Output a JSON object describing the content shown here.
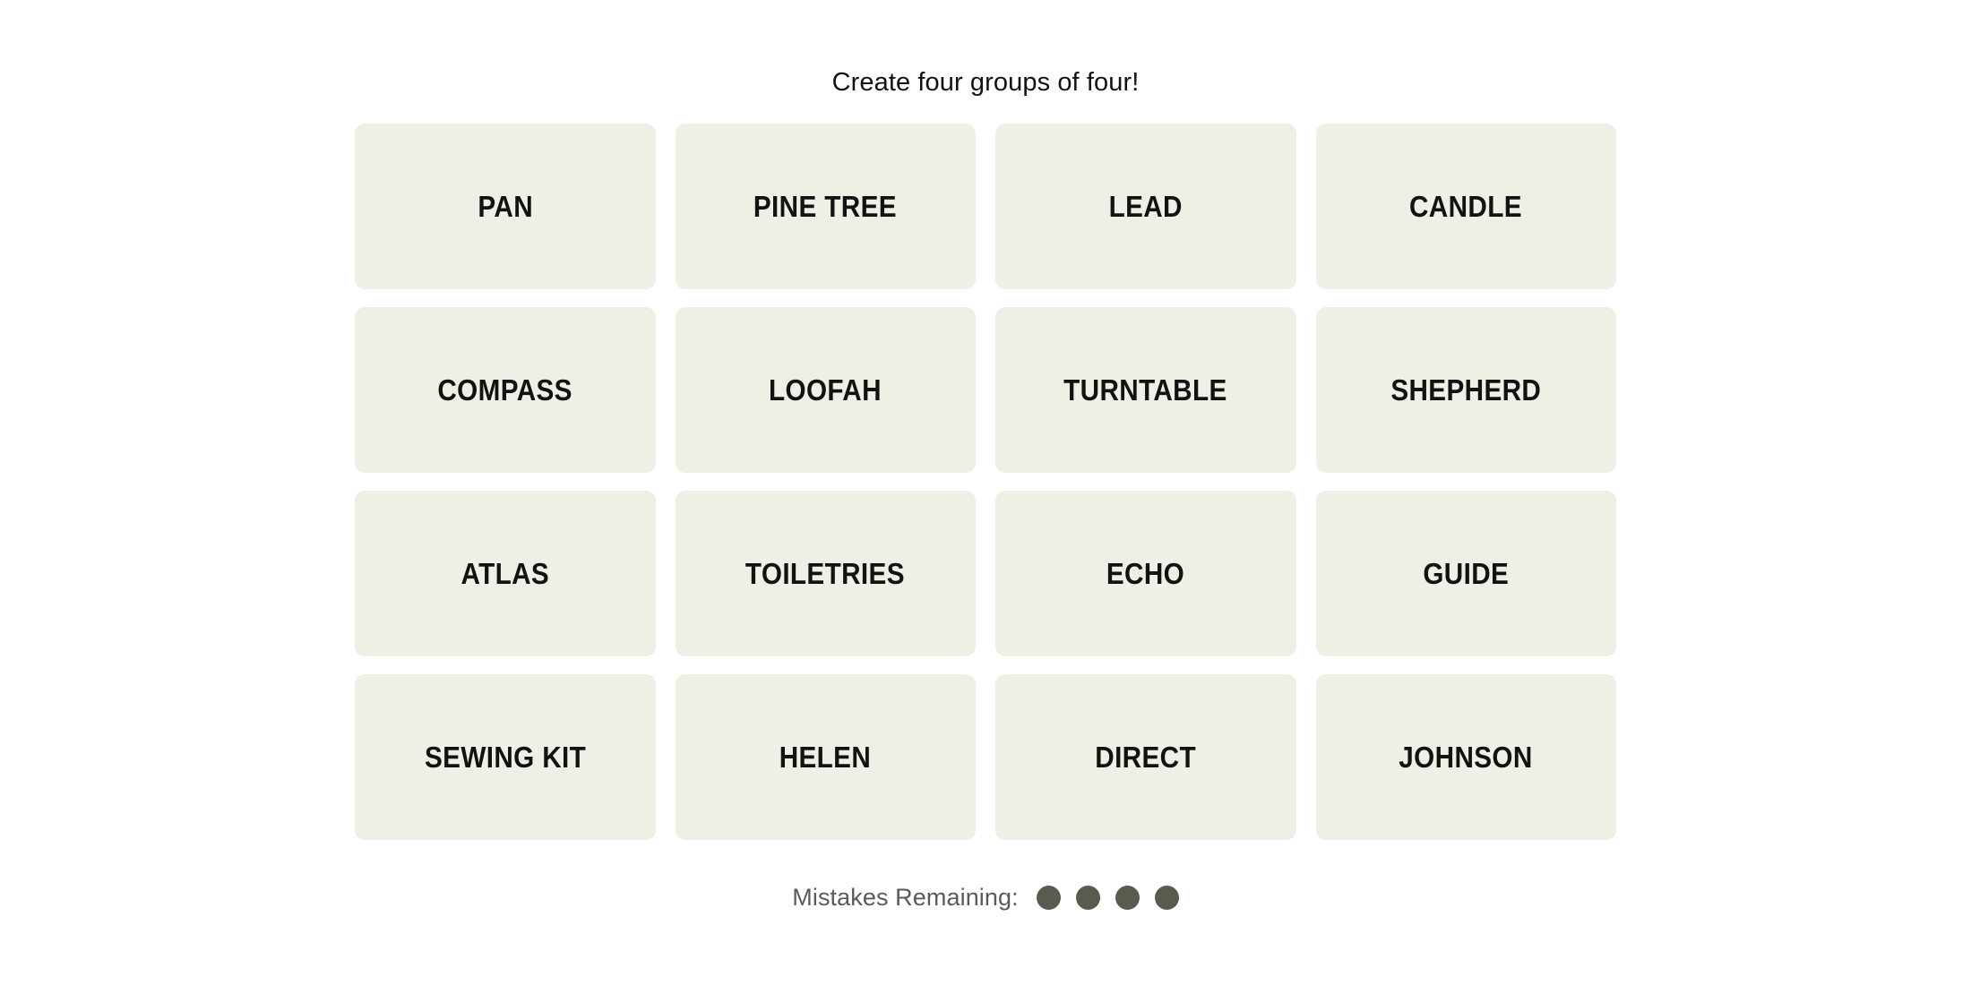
{
  "header": {
    "instruction": "Create four groups of four!"
  },
  "board": {
    "rows": 4,
    "columns": 4,
    "tile_background": "#EFEFE6",
    "tile_text_color": "#121212",
    "tiles": [
      {
        "label": "PAN"
      },
      {
        "label": "PINE TREE"
      },
      {
        "label": "LEAD"
      },
      {
        "label": "CANDLE"
      },
      {
        "label": "COMPASS"
      },
      {
        "label": "LOOFAH"
      },
      {
        "label": "TURNTABLE"
      },
      {
        "label": "SHEPHERD"
      },
      {
        "label": "ATLAS"
      },
      {
        "label": "TOILETRIES"
      },
      {
        "label": "ECHO"
      },
      {
        "label": "GUIDE"
      },
      {
        "label": "SEWING KIT"
      },
      {
        "label": "HELEN"
      },
      {
        "label": "DIRECT"
      },
      {
        "label": "JOHNSON"
      }
    ]
  },
  "footer": {
    "mistakes_label": "Mistakes Remaining:",
    "mistakes_remaining": 4,
    "bubble_color": "#5A5A4E",
    "label_color": "#5A5A5A",
    "bubbles": [
      {
        "name": "mistake-bubble-1"
      },
      {
        "name": "mistake-bubble-2"
      },
      {
        "name": "mistake-bubble-3"
      },
      {
        "name": "mistake-bubble-4"
      }
    ]
  },
  "page": {
    "background": "#FFFFFF"
  }
}
